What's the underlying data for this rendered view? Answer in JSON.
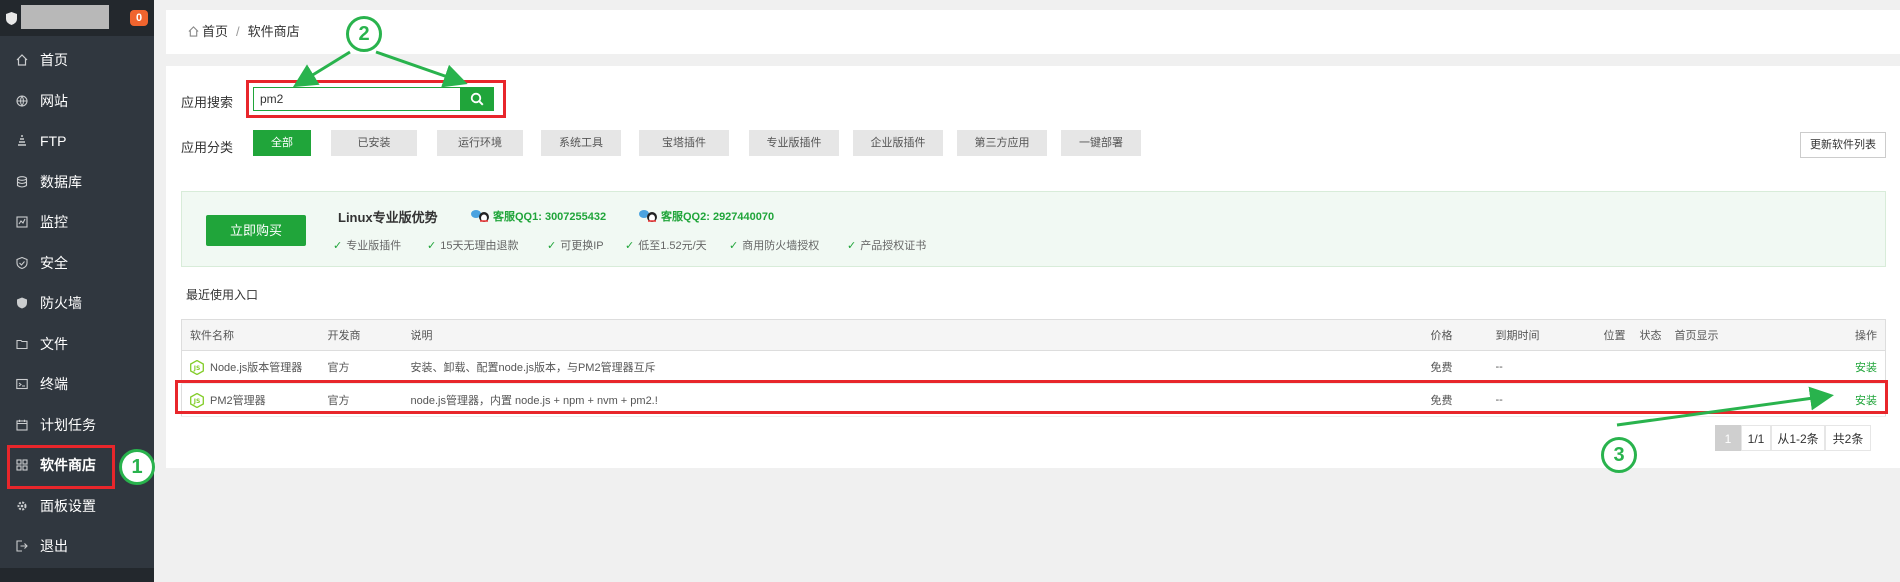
{
  "brand": {
    "badge_count": "0"
  },
  "sidebar": {
    "items": [
      {
        "label": "首页",
        "icon": "home-icon"
      },
      {
        "label": "网站",
        "icon": "globe-icon"
      },
      {
        "label": "FTP",
        "icon": "ftp-icon"
      },
      {
        "label": "数据库",
        "icon": "database-icon"
      },
      {
        "label": "监控",
        "icon": "monitor-icon"
      },
      {
        "label": "安全",
        "icon": "shield-icon"
      },
      {
        "label": "防火墙",
        "icon": "firewall-icon"
      },
      {
        "label": "文件",
        "icon": "folder-icon"
      },
      {
        "label": "终端",
        "icon": "terminal-icon"
      },
      {
        "label": "计划任务",
        "icon": "calendar-icon"
      },
      {
        "label": "软件商店",
        "icon": "grid-icon",
        "active": true
      },
      {
        "label": "面板设置",
        "icon": "gear-icon"
      },
      {
        "label": "退出",
        "icon": "logout-icon"
      }
    ]
  },
  "breadcrumb": {
    "home": "首页",
    "separator": "/",
    "current": "软件商店"
  },
  "search": {
    "label": "应用搜索",
    "value": "pm2"
  },
  "category": {
    "label": "应用分类",
    "tabs": [
      "全部",
      "已安装",
      "运行环境",
      "系统工具",
      "宝塔插件",
      "专业版插件",
      "企业版插件",
      "第三方应用",
      "一键部署"
    ],
    "active": "全部"
  },
  "refresh_label": "更新软件列表",
  "promo": {
    "buy_label": "立即购买",
    "title": "Linux专业版优势",
    "qq1": "客服QQ1: 3007255432",
    "qq2": "客服QQ2: 2927440070",
    "features": [
      "专业版插件",
      "15天无理由退款",
      "可更换IP",
      "低至1.52元/天",
      "商用防火墙授权",
      "产品授权证书"
    ]
  },
  "recent_label": "最近使用入口",
  "table": {
    "headers": {
      "name": "软件名称",
      "developer": "开发商",
      "desc": "说明",
      "price": "价格",
      "expire": "到期时间",
      "location": "位置",
      "status": "状态",
      "homepage": "首页显示",
      "action": "操作"
    },
    "rows": [
      {
        "name": "Node.js版本管理器",
        "developer": "官方",
        "desc": "安装、卸载、配置node.js版本，与PM2管理器互斥",
        "price": "免费",
        "expire": "--",
        "action": "安装"
      },
      {
        "name": "PM2管理器",
        "developer": "官方",
        "desc": "node.js管理器，内置 node.js + npm + nvm + pm2.!",
        "price": "免费",
        "expire": "--",
        "action": "安装"
      }
    ]
  },
  "pagination": {
    "current": "1",
    "pages": "1/1",
    "range": "从1-2条",
    "total": "共2条"
  },
  "annotations": [
    "1",
    "2",
    "3"
  ],
  "colors": {
    "accent": "#20a53a",
    "sidebar": "#30373f",
    "annotation_box": "#e8262b",
    "annotation_circle": "#29b34d"
  }
}
